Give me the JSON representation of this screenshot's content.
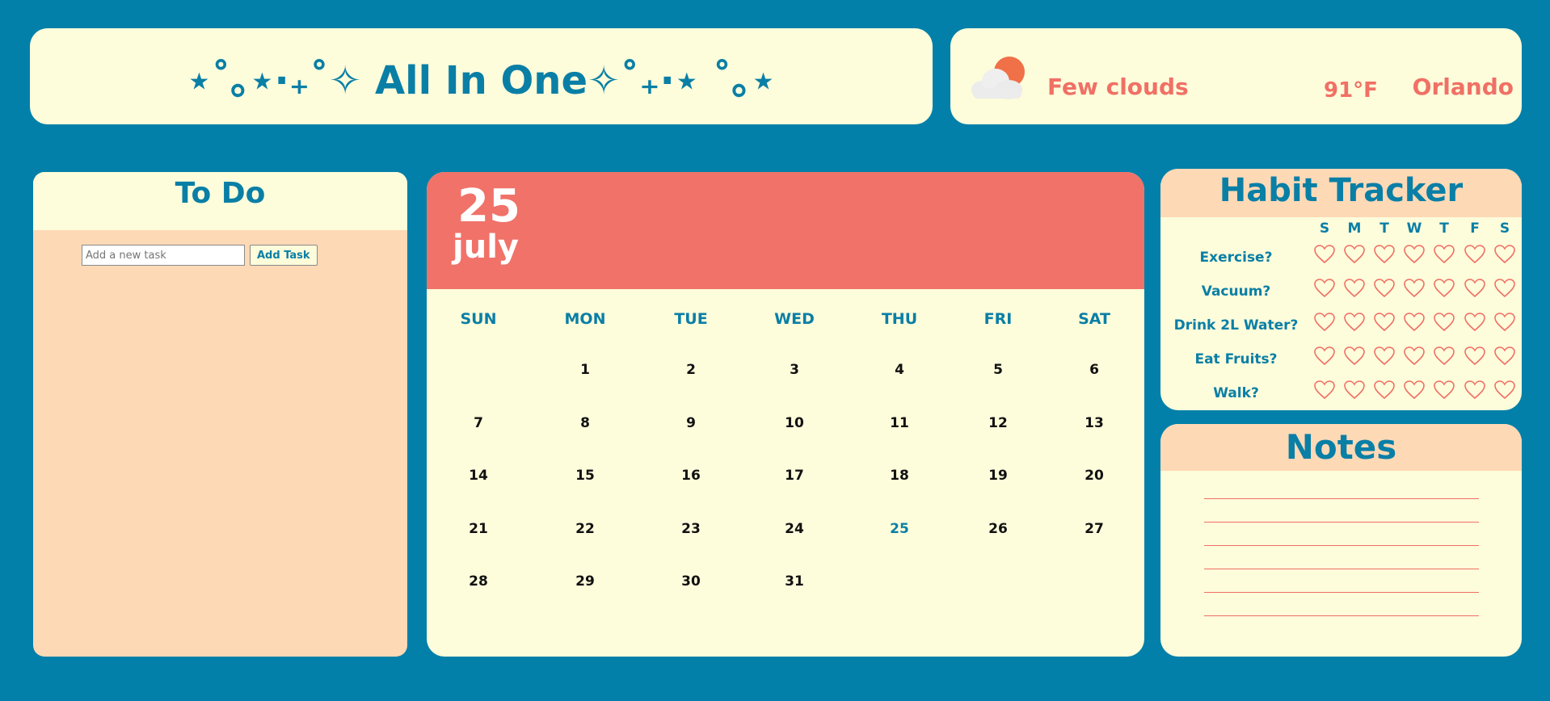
{
  "app": {
    "title": "⋆˚｡⋆·₊˚✧ All In One✧˚₊·⋆ ˚｡⋆"
  },
  "weather": {
    "description": "Few clouds",
    "temperature": "91°F",
    "city": "Orlando",
    "icon": "partly-cloudy-icon"
  },
  "todo": {
    "title": "To Do",
    "input_placeholder": "Add a new task",
    "add_button_label": "Add Task"
  },
  "calendar": {
    "day": "25",
    "month": "july",
    "weekdays": [
      "SUN",
      "MON",
      "TUE",
      "WED",
      "THU",
      "FRI",
      "SAT"
    ],
    "weeks": [
      [
        "",
        "1",
        "2",
        "3",
        "4",
        "5",
        "6"
      ],
      [
        "7",
        "8",
        "9",
        "10",
        "11",
        "12",
        "13"
      ],
      [
        "14",
        "15",
        "16",
        "17",
        "18",
        "19",
        "20"
      ],
      [
        "21",
        "22",
        "23",
        "24",
        "25",
        "26",
        "27"
      ],
      [
        "28",
        "29",
        "30",
        "31",
        "",
        "",
        ""
      ]
    ],
    "today": "25"
  },
  "habits": {
    "title": "Habit Tracker",
    "day_letters": [
      "S",
      "M",
      "T",
      "W",
      "T",
      "F",
      "S"
    ],
    "items": [
      {
        "label": "Exercise?"
      },
      {
        "label": "Vacuum?"
      },
      {
        "label": "Drink 2L Water?"
      },
      {
        "label": "Eat Fruits?"
      },
      {
        "label": "Walk?"
      }
    ]
  },
  "notes": {
    "title": "Notes",
    "line_count": 6
  },
  "colors": {
    "background": "#0280a9",
    "card": "#fdfcdb",
    "peach": "#fed9b6",
    "coral": "#f07269",
    "teal": "#0a7fa6"
  }
}
